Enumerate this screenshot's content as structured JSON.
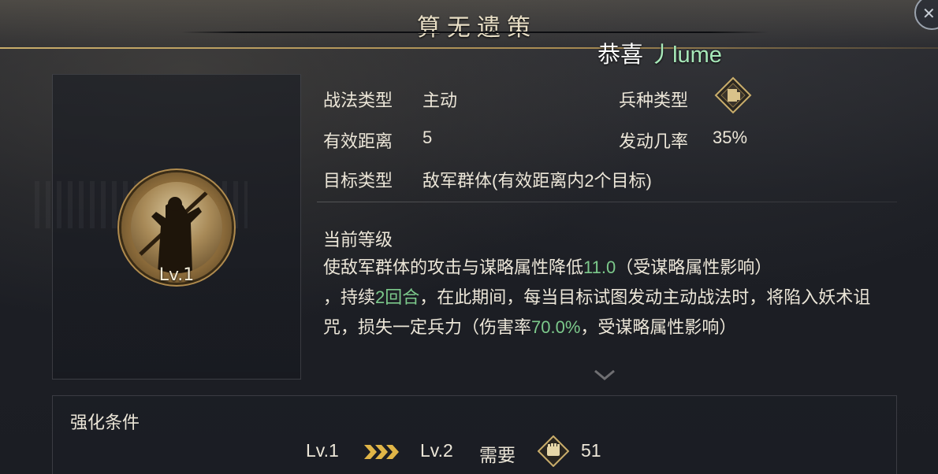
{
  "header": {
    "title": "算无遗策",
    "congrats_prefix": "恭喜",
    "congrats_player": "丿lume",
    "close_icon": "close-icon"
  },
  "skill": {
    "avatar_level": "Lv.1",
    "type_label": "战法类型",
    "type_value": "主动",
    "troop_type_label": "兵种类型",
    "troop_type_icon": "troop-type-icon",
    "range_label": "有效距离",
    "range_value": "5",
    "trigger_label": "发动几率",
    "trigger_value": "35%",
    "target_label": "目标类型",
    "target_value": "敌军群体(有效距离内2个目标)"
  },
  "current_level": {
    "title": "当前等级",
    "desc_1": "使敌军群体的攻击与谋略属性降低",
    "value_1": "11.0",
    "desc_2": "（受谋略属性影响）",
    "desc_3": "，持续",
    "value_2": "2回合",
    "desc_4": "，在此期间，每当目标试图发动主动战法时，将陷入妖术诅咒，损失一定兵力（伤害率",
    "value_3": "70.0%",
    "desc_5": "，受谋略属性影响）"
  },
  "enhance": {
    "title": "强化条件",
    "from_level": "Lv.1",
    "to_level": "Lv.2",
    "need_label": "需要",
    "cost_icon": "fist-icon",
    "cost_value": "51"
  },
  "colors": {
    "highlight": "#7cc98b",
    "gold": "#c9ad6b",
    "player_name": "#a7e9b9"
  }
}
